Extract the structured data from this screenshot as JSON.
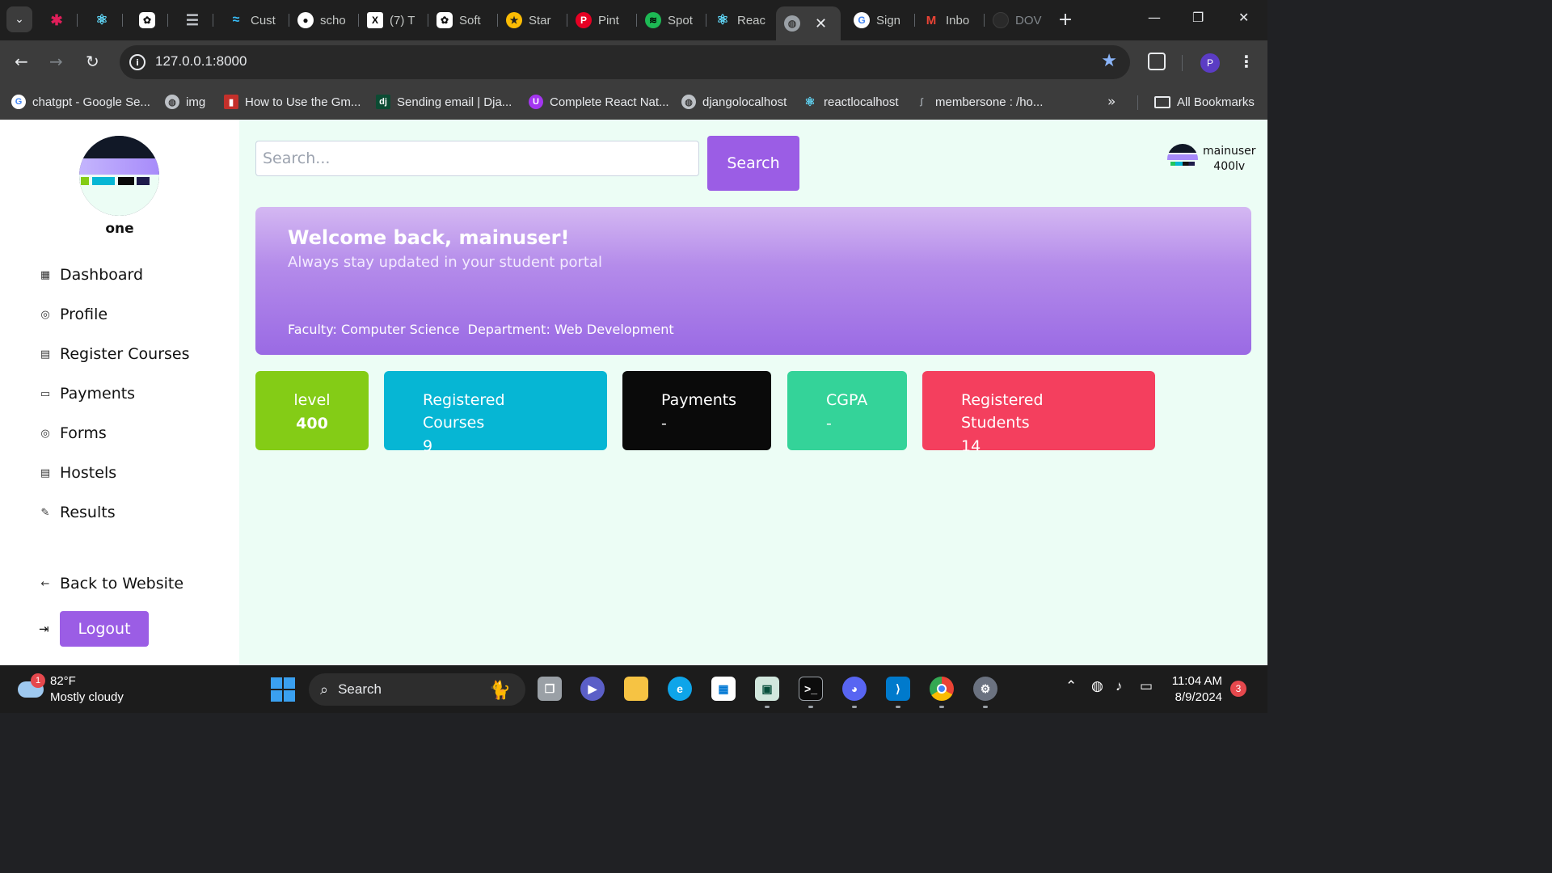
{
  "browser": {
    "tabs": [
      {
        "label": "",
        "icon": "slack-icon",
        "color": "#e01e5a"
      },
      {
        "label": "",
        "icon": "react-icon",
        "color": "#61dafb"
      },
      {
        "label": "",
        "icon": "chatgpt-icon",
        "color": "#ffffff"
      },
      {
        "label": "",
        "icon": "list-icon",
        "color": "#bdc1c6"
      },
      {
        "label": "Cust",
        "icon": "tailwind-icon",
        "color": "#38bdf8"
      },
      {
        "label": "scho",
        "icon": "github-icon",
        "color": "#ffffff"
      },
      {
        "label": "(7) T",
        "icon": "x-icon",
        "color": "#000000"
      },
      {
        "label": "Soft",
        "icon": "chatgpt-icon",
        "color": "#ffffff"
      },
      {
        "label": "Star",
        "icon": "star-badge-icon",
        "color": "#fbbc04"
      },
      {
        "label": "Pint",
        "icon": "pinterest-icon",
        "color": "#e60023"
      },
      {
        "label": "Spot",
        "icon": "spotify-icon",
        "color": "#1db954"
      },
      {
        "label": "Reac",
        "icon": "react-icon",
        "color": "#61dafb"
      },
      {
        "label": "",
        "icon": "globe-icon",
        "color": "#9aa0a6"
      },
      {
        "label": "Sign",
        "icon": "google-icon",
        "color": "#4285f4"
      },
      {
        "label": "Inbo",
        "icon": "gmail-icon",
        "color": "#ea4335"
      },
      {
        "label": "DOV",
        "icon": "dot-icon",
        "color": "#3c3c3c"
      }
    ],
    "url": "127.0.0.1:8000",
    "profile_initial": "P",
    "bookmarks": [
      {
        "label": "chatgpt - Google Se...",
        "icon": "google-icon",
        "color": "#4285f4"
      },
      {
        "label": "img",
        "icon": "globe-icon",
        "color": "#9aa0a6"
      },
      {
        "label": "How to Use the Gm...",
        "icon": "youtube-icon",
        "color": "#c4302b"
      },
      {
        "label": "Sending email | Dja...",
        "icon": "django-icon",
        "color": "#0c4b33"
      },
      {
        "label": "Complete React Nat...",
        "icon": "udemy-icon",
        "color": "#a435f0"
      },
      {
        "label": "djangolocalhost",
        "icon": "globe-icon",
        "color": "#9aa0a6"
      },
      {
        "label": "reactlocalhost",
        "icon": "react-icon",
        "color": "#61dafb"
      },
      {
        "label": "membersone : /ho...",
        "icon": "python-icon",
        "color": "#5f6368"
      }
    ],
    "all_bookmarks": "All Bookmarks"
  },
  "sidebar": {
    "user_name": "one",
    "nav": [
      {
        "label": "Dashboard",
        "icon": "grid-icon",
        "glyph": "▦"
      },
      {
        "label": "Profile",
        "icon": "user-icon",
        "glyph": "◎"
      },
      {
        "label": "Register Courses",
        "icon": "building-icon",
        "glyph": "▤"
      },
      {
        "label": "Payments",
        "icon": "credit-card-icon",
        "glyph": "▭"
      },
      {
        "label": "Forms",
        "icon": "user-icon",
        "glyph": "◎"
      },
      {
        "label": "Hostels",
        "icon": "building-icon",
        "glyph": "▤"
      },
      {
        "label": "Results",
        "icon": "pen-icon",
        "glyph": "✎"
      }
    ],
    "back_label": "Back to Website",
    "logout_label": "Logout"
  },
  "header": {
    "search_placeholder": "Search...",
    "search_button": "Search",
    "user_name": "mainuser",
    "user_level": "400lv"
  },
  "banner": {
    "title": "Welcome back, mainuser!",
    "subtitle": "Always stay updated in your student portal",
    "faculty": "Faculty: Computer Science",
    "department": "Department: Web Development"
  },
  "stats": [
    {
      "label": "level",
      "value": "400",
      "color": "#84cc16"
    },
    {
      "label": "Registered Courses",
      "value": "9",
      "color": "#06b6d4"
    },
    {
      "label": "Payments",
      "value": "-",
      "color": "#0a0a0a"
    },
    {
      "label": "CGPA",
      "value": "-",
      "color": "#34d399"
    },
    {
      "label": "Registered Students",
      "value": "14",
      "color": "#f43f5e"
    }
  ],
  "taskbar": {
    "weather_temp": "82°F",
    "weather_desc": "Mostly cloudy",
    "weather_badge": "1",
    "search_label": "Search",
    "time": "11:04 AM",
    "date": "8/9/2024",
    "notifications": "3"
  }
}
